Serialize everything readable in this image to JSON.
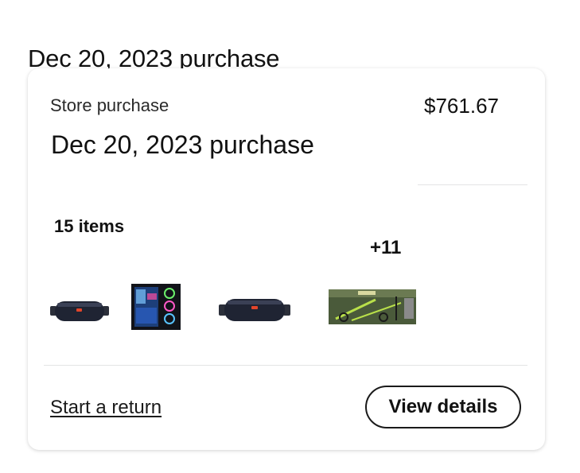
{
  "page": {
    "heading": "Dec 20, 2023 purchase"
  },
  "order": {
    "store_label": "Store purchase",
    "total": "$761.67",
    "title": "Dec 20, 2023 purchase",
    "item_count_label": "15 items",
    "more_items_label": "+11",
    "thumbnails": [
      {
        "icon": "bluetooth-speaker"
      },
      {
        "icon": "gaming-pc-case"
      },
      {
        "icon": "bluetooth-speaker"
      },
      {
        "icon": "electric-scooter-box"
      }
    ]
  },
  "actions": {
    "start_return": "Start a return",
    "view_details": "View details"
  }
}
